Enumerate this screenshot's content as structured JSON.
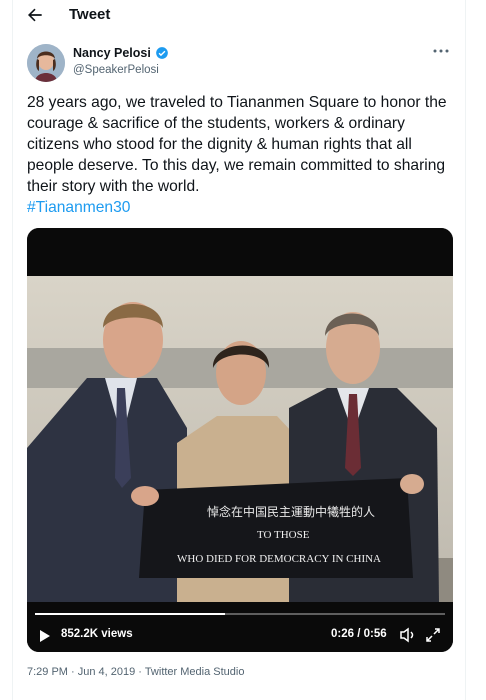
{
  "header": {
    "title": "Tweet",
    "back_icon": "arrow-left-icon"
  },
  "author": {
    "name": "Nancy Pelosi",
    "handle": "@SpeakerPelosi",
    "verified_icon": "verified-badge-icon",
    "verified_color": "#1d9bf0"
  },
  "tweet": {
    "text": "28 years ago, we traveled to Tiananmen Square to honor the courage & sacrifice of the students, workers & ordinary citizens who stood for the dignity & human rights that all people deserve. To this day, we remain committed to sharing their story with the world.",
    "hashtag": "#Tiananmen30",
    "hashtag_color": "#1d9bf0"
  },
  "media": {
    "banner_line1": "TO THOSE",
    "banner_line2": "WHO DIED FOR DEMOCRACY IN CHINA",
    "views": "852.2K views",
    "time": "0:26 / 0:56",
    "progress": 0.464,
    "play_icon": "play-icon",
    "volume_icon": "volume-icon",
    "fullscreen_icon": "fullscreen-icon"
  },
  "meta": {
    "timestamp": "7:29 PM · Jun 4, 2019 · ",
    "source": "Twitter Media Studio"
  },
  "more_icon": "more-options-icon"
}
